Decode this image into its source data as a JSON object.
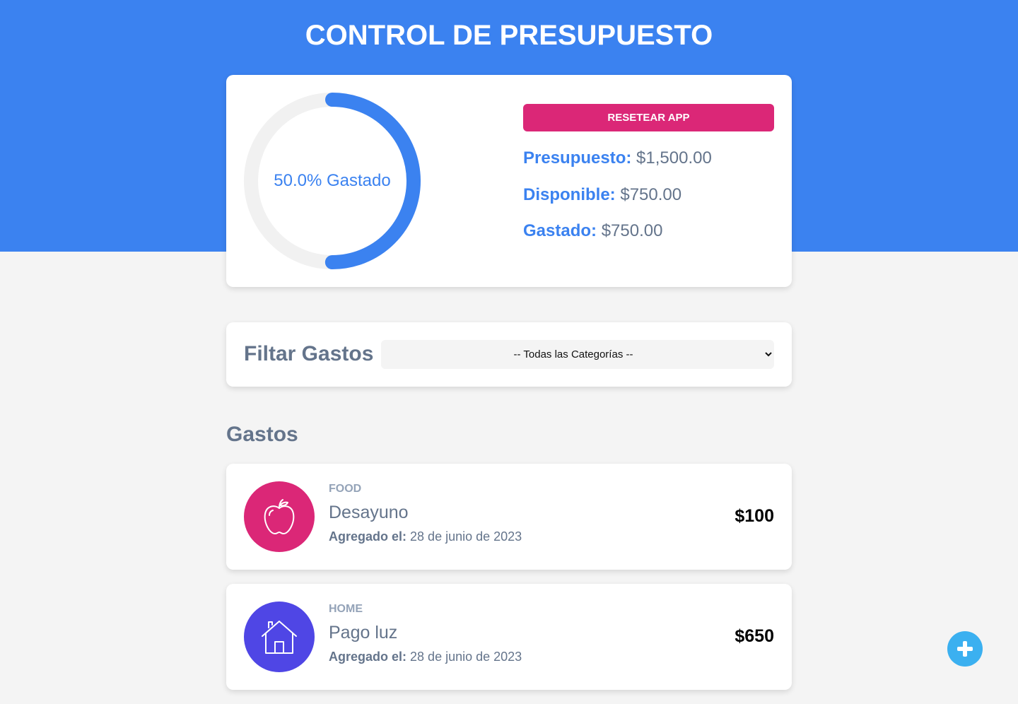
{
  "header": {
    "title": "CONTROL DE PRESUPUESTO",
    "background": "#3b82f0"
  },
  "budget": {
    "percent_spent": 50.0,
    "progress_label": "50.0% Gastado",
    "reset_label": "RESETEAR APP",
    "stats": [
      {
        "label": "Presupuesto:",
        "value": "$1,500.00"
      },
      {
        "label": "Disponible:",
        "value": "$750.00"
      },
      {
        "label": "Gastado:",
        "value": "$750.00"
      }
    ]
  },
  "filter": {
    "label": "Filtar Gastos",
    "selected": "-- Todas las Categorías --"
  },
  "expenses_section": {
    "title": "Gastos",
    "items": [
      {
        "category": "FOOD",
        "name": "Desayuno",
        "date_label": "Agregado el:",
        "date": "28 de junio de 2023",
        "amount": "$100",
        "icon": "apple-icon",
        "color": "#db2777"
      },
      {
        "category": "HOME",
        "name": "Pago luz",
        "date_label": "Agregado el:",
        "date": "28 de junio de 2023",
        "amount": "$650",
        "icon": "house-icon",
        "color": "#4f46e5"
      }
    ]
  },
  "colors": {
    "accent": "#3b82f0",
    "reset": "#db2777",
    "fab": "#3bb0f0"
  },
  "fab": {
    "icon": "plus-icon"
  }
}
